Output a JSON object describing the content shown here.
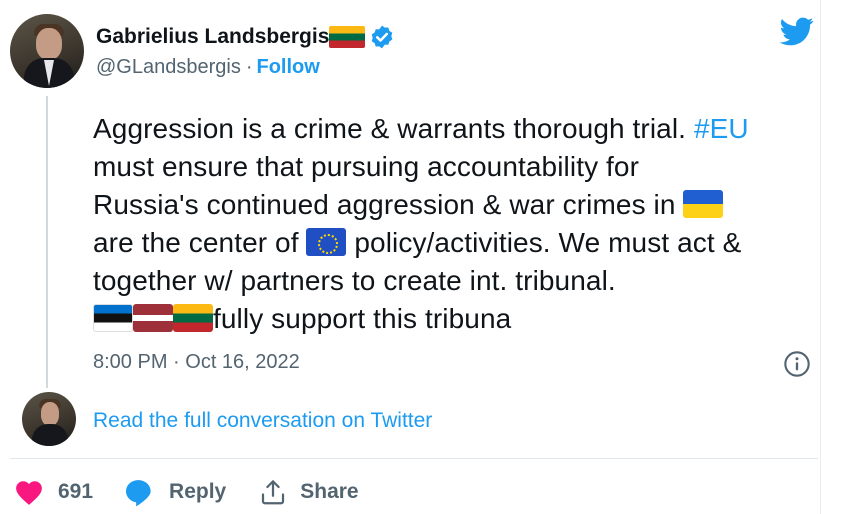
{
  "tweet": {
    "author_name": "Gabrielius Landsbergis",
    "handle": "@GLandsbergis",
    "separator": "·",
    "follow_label": "Follow",
    "text_lines": {
      "l1_a": "Aggression is a crime & warrants thorough trial. ",
      "l1_hashtag": "#EU",
      "l2": "must ensure that pursuing accountability for",
      "l3_a": "Russia's continued aggression & war crimes in ",
      "l4_a": "are the center of ",
      "l4_b": " policy/activities. We must act &",
      "l5": "together w/ partners to create int. tribunal.",
      "l6_b": "fully support this tribuna"
    },
    "timestamp": "8:00 PM · Oct 16, 2022",
    "read_full_label": "Read the full conversation on Twitter"
  },
  "actions": {
    "like_count": "691",
    "reply_label": "Reply",
    "share_label": "Share"
  },
  "icons": {
    "verified": "verified-badge-icon",
    "twitter": "twitter-bird-icon",
    "info": "info-icon",
    "heart": "heart-icon",
    "reply": "reply-bubble-icon",
    "share": "share-icon"
  },
  "colors": {
    "accent": "#1d9bf0",
    "like": "#f91880",
    "muted": "#536471",
    "text": "#0f1419"
  }
}
